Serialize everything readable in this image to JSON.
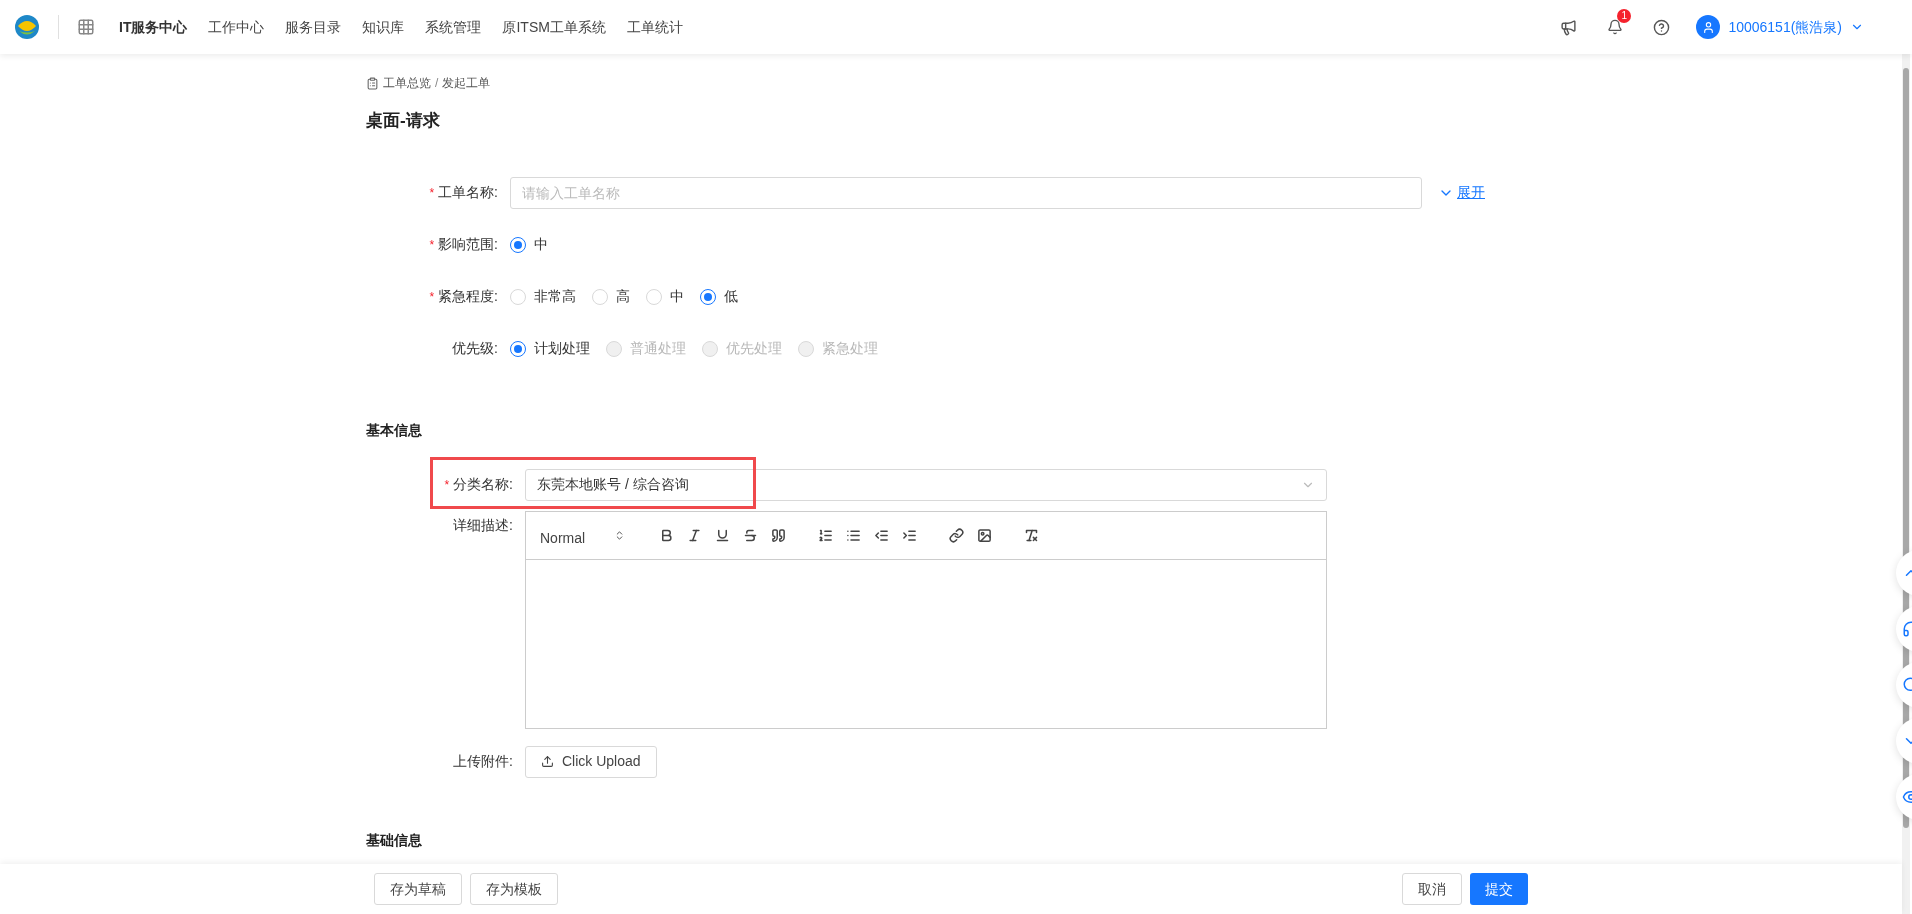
{
  "header": {
    "nav": [
      {
        "label": "IT服务中心",
        "selected": true
      },
      {
        "label": "工作中心",
        "selected": false
      },
      {
        "label": "服务目录",
        "selected": false
      },
      {
        "label": "知识库",
        "selected": false
      },
      {
        "label": "系统管理",
        "selected": false
      },
      {
        "label": "原ITSM工单系统",
        "selected": false
      },
      {
        "label": "工单统计",
        "selected": false
      }
    ],
    "notification_count": "1",
    "user": "10006151(熊浩泉)"
  },
  "breadcrumb": [
    "工单总览",
    "发起工单"
  ],
  "breadcrumb_separator": "/",
  "page_title": "桌面-请求",
  "form": {
    "title_field": {
      "label": "工单名称:",
      "required_mark": "*",
      "placeholder": "请输入工单名称",
      "expand_link": "展开"
    },
    "radio_groups": [
      {
        "label": "影响范围:",
        "required_mark": "*",
        "options": [
          {
            "label": "中",
            "selected": true,
            "disabled": false
          }
        ]
      },
      {
        "label": "紧急程度:",
        "required_mark": "*",
        "options": [
          {
            "label": "非常高",
            "selected": false,
            "disabled": false
          },
          {
            "label": "高",
            "selected": false,
            "disabled": false
          },
          {
            "label": "中",
            "selected": false,
            "disabled": false
          },
          {
            "label": "低",
            "selected": true,
            "disabled": false
          }
        ]
      },
      {
        "label": "优先级:",
        "options": [
          {
            "label": "计划处理",
            "selected": true,
            "disabled": false
          },
          {
            "label": "普通处理",
            "selected": false,
            "disabled": true
          },
          {
            "label": "优先处理",
            "selected": false,
            "disabled": true
          },
          {
            "label": "紧急处理",
            "selected": false,
            "disabled": true
          }
        ]
      }
    ]
  },
  "basic_info": {
    "heading": "基本信息",
    "category": {
      "label": "分类名称:",
      "required_mark": "*",
      "value": "东莞本地账号 / 综合咨询",
      "highlighted": true
    },
    "description": {
      "label": "详细描述:",
      "format": "Normal"
    },
    "attachment": {
      "label": "上传附件:",
      "button": "Click Upload"
    }
  },
  "next_section": "基础信息",
  "footer": {
    "left_buttons": [
      "存为草稿",
      "存为模板"
    ],
    "cancel": "取消",
    "submit": "提交"
  }
}
